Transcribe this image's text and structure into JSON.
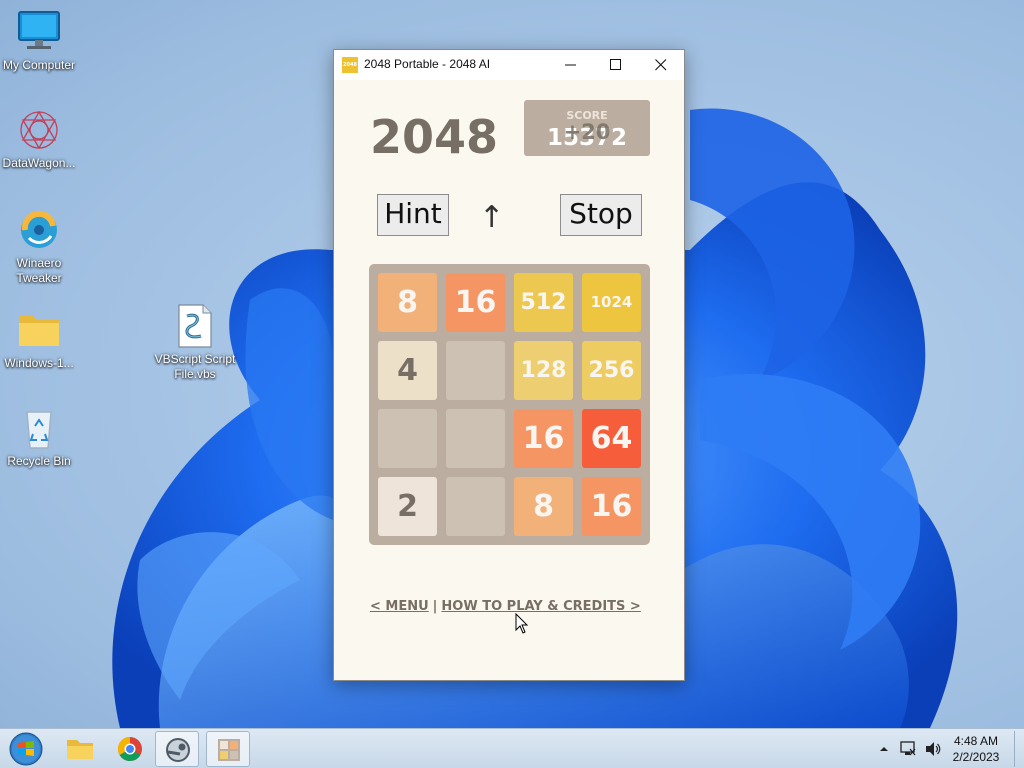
{
  "desktop": {
    "icons": [
      {
        "label": "My Computer"
      },
      {
        "label": "DataWagon..."
      },
      {
        "label": "Winaero Tweaker"
      },
      {
        "label": "Windows-1..."
      },
      {
        "label": "Recycle Bin"
      },
      {
        "label": "VBScript Script File.vbs"
      }
    ]
  },
  "window": {
    "title": "2048 Portable - 2048 AI",
    "app_icon_text": "2048",
    "controls": {
      "minimize": "minimize-icon",
      "maximize": "maximize-icon",
      "close": "close-icon"
    }
  },
  "game": {
    "title": "2048",
    "score_label": "SCORE",
    "score_value": "15372",
    "score_addition": "+20",
    "hint_label": "Hint",
    "direction_arrow": "↑",
    "stop_label": "Stop",
    "board": [
      [
        "8",
        "16",
        "512",
        "1024"
      ],
      [
        "4",
        "",
        "128",
        "256"
      ],
      [
        "",
        "",
        "16",
        "64"
      ],
      [
        "2",
        "",
        "8",
        "16"
      ]
    ],
    "tile_colors": {
      "": "#cdc1b4",
      "2": "#eee4da",
      "4": "#ede0c8",
      "8": "#f2b179",
      "16": "#f59563",
      "64": "#f65e3b",
      "128": "#edcf72",
      "256": "#edcc61",
      "512": "#edc850",
      "1024": "#edc53f"
    },
    "menu_link": "< MENU",
    "separator": "|",
    "howto_link": "HOW TO PLAY & CREDITS >"
  },
  "taskbar": {
    "items": [
      "start-orb-icon",
      "file-explorer-icon",
      "chrome-icon",
      "steam-icon",
      "2048-app-icon"
    ],
    "tray": {
      "time": "4:48 AM",
      "date": "2/2/2023"
    }
  }
}
